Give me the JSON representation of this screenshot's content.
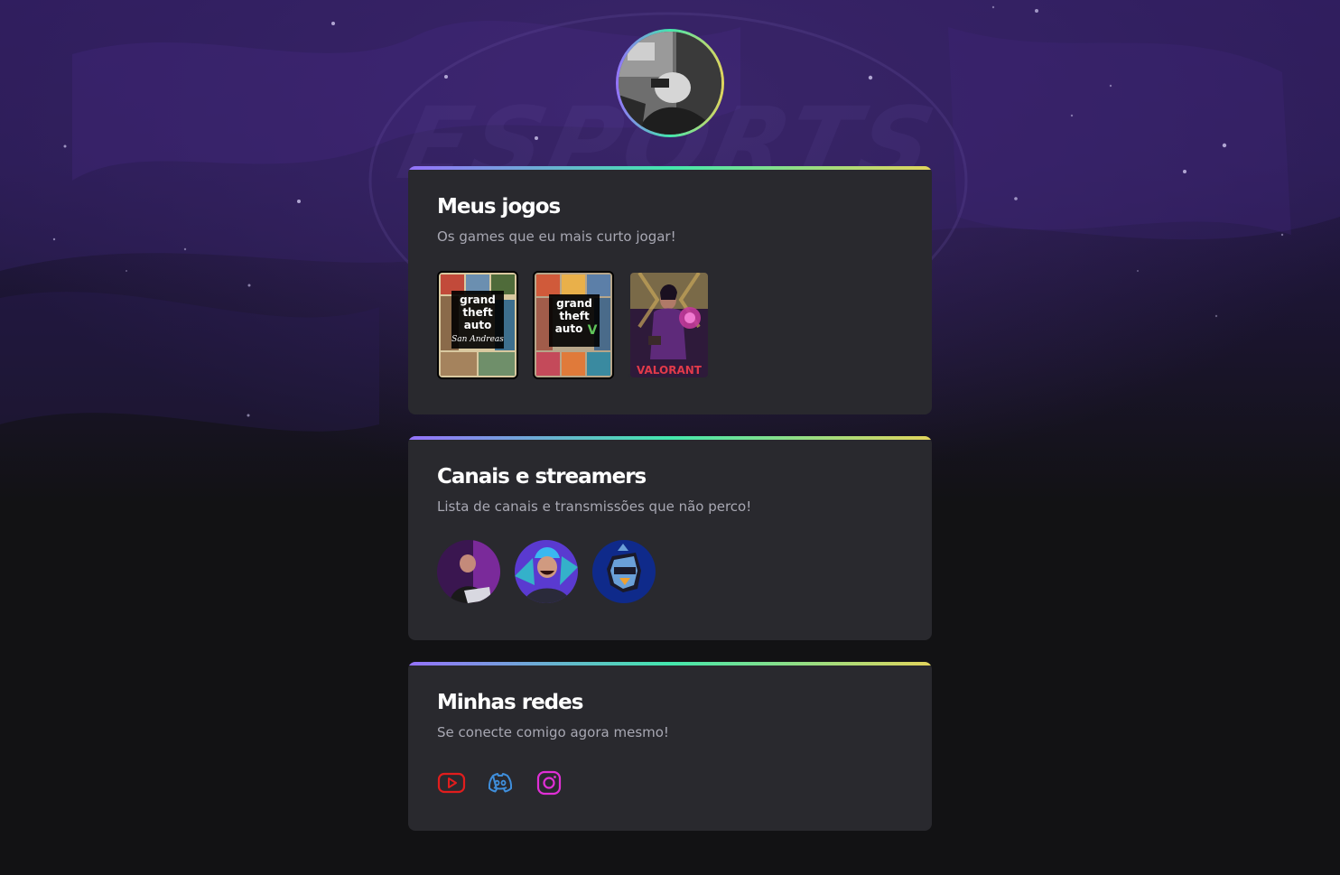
{
  "profile": {
    "avatar_alt": "profile-photo",
    "gradient": [
      "#9572fc",
      "#43e7ad",
      "#e2d45c"
    ]
  },
  "background": {
    "watermark_text": "ESPORTS",
    "colors": {
      "top": "#2b1a55",
      "bottom": "#121214",
      "card": "#29292e"
    }
  },
  "games_section": {
    "title": "Meus jogos",
    "subtitle": "Os games que eu mais curto jogar!",
    "games": [
      {
        "name": "gta-san-andreas-cover",
        "cover_lines": [
          "grand",
          "theft",
          "auto",
          "San Andreas"
        ]
      },
      {
        "name": "gta-v-cover",
        "cover_lines": [
          "grand",
          "theft",
          "auto",
          "V"
        ]
      },
      {
        "name": "valorant-cover",
        "cover_lines": [
          "VALORANT"
        ]
      }
    ]
  },
  "streamers_section": {
    "title": "Canais e streamers",
    "subtitle": "Lista de canais e transmissões que não perco!",
    "streamers": [
      {
        "name": "streamer-1-avatar"
      },
      {
        "name": "streamer-2-avatar"
      },
      {
        "name": "streamer-3-avatar"
      }
    ]
  },
  "social_section": {
    "title": "Minhas redes",
    "subtitle": "Se conecte comigo agora mesmo!",
    "links": [
      {
        "icon": "youtube-icon",
        "color": "#e11d1d"
      },
      {
        "icon": "discord-icon",
        "color": "#3f8edb"
      },
      {
        "icon": "instagram-icon",
        "color": "#e02fd6"
      }
    ]
  }
}
